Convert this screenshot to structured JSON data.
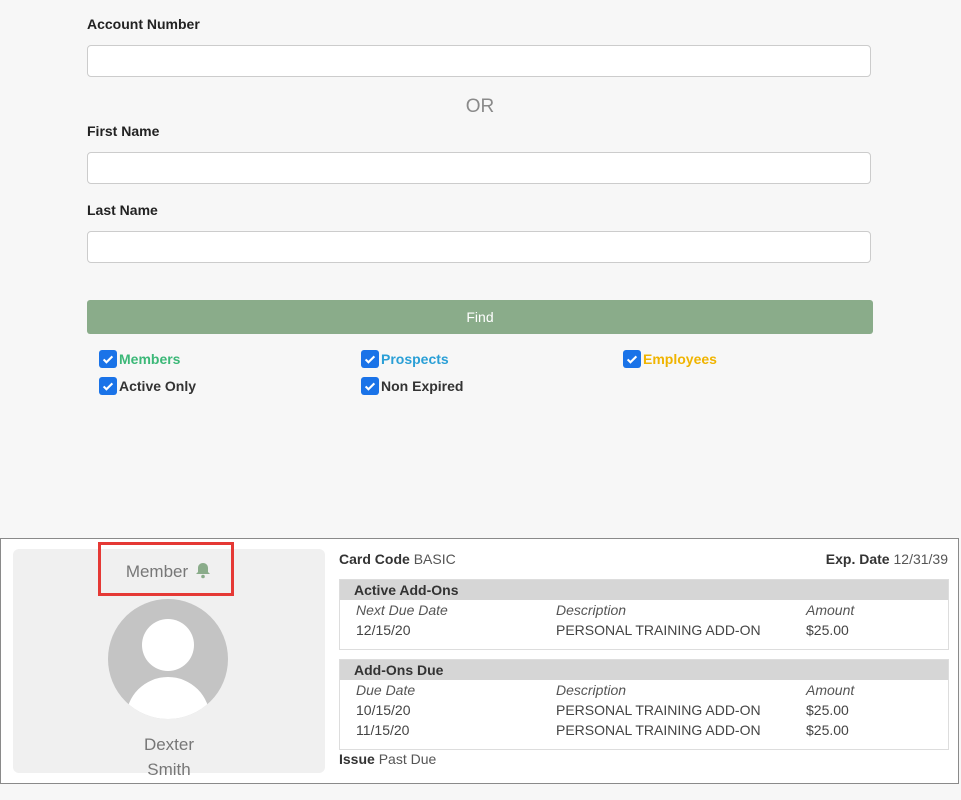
{
  "search": {
    "account_label": "Account Number",
    "account_value": "",
    "or_text": "OR",
    "first_name_label": "First Name",
    "first_name_value": "",
    "last_name_label": "Last Name",
    "last_name_value": "",
    "find_label": "Find"
  },
  "filters": [
    {
      "label": "Members",
      "checked": true,
      "color": "#3cb878"
    },
    {
      "label": "Prospects",
      "checked": true,
      "color": "#2a9fd6"
    },
    {
      "label": "Employees",
      "checked": true,
      "color": "#f0b400"
    },
    {
      "label": "Active Only",
      "checked": true,
      "color": "#222222"
    },
    {
      "label": "Non Expired",
      "checked": true,
      "color": "#222222"
    }
  ],
  "result": {
    "type": "Member",
    "first_name": "Dexter",
    "last_name": "Smith",
    "card_code_label": "Card Code",
    "card_code_value": "BASIC",
    "exp_date_label": "Exp. Date",
    "exp_date_value": "12/31/39",
    "active_addons": {
      "title": "Active Add-Ons",
      "headers": [
        "Next Due Date",
        "Description",
        "Amount"
      ],
      "rows": [
        [
          "12/15/20",
          "PERSONAL TRAINING ADD-ON",
          "$25.00"
        ]
      ]
    },
    "addons_due": {
      "title": "Add-Ons Due",
      "headers": [
        "Due Date",
        "Description",
        "Amount"
      ],
      "rows": [
        [
          "10/15/20",
          "PERSONAL TRAINING ADD-ON",
          "$25.00"
        ],
        [
          "11/15/20",
          "PERSONAL TRAINING ADD-ON",
          "$25.00"
        ]
      ]
    },
    "issue_label": "Issue",
    "issue_value": "Past Due"
  },
  "colors": {
    "find_button": "#8aac8a",
    "checkbox": "#1a73e8",
    "bell": "#8aac8a",
    "highlight": "#e53935"
  }
}
